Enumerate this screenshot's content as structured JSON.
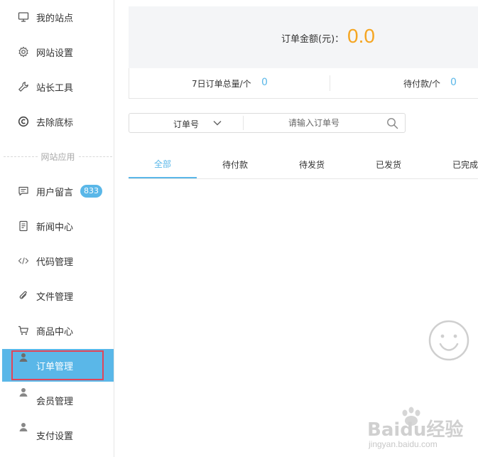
{
  "sidebar": {
    "items": [
      {
        "label": "我的站点",
        "icon": "monitor-icon"
      },
      {
        "label": "网站设置",
        "icon": "gear-icon"
      },
      {
        "label": "站长工具",
        "icon": "wrench-icon"
      },
      {
        "label": "去除底标",
        "icon": "copyright-icon"
      },
      {
        "label": "用户留言",
        "icon": "message-icon",
        "badge": "833"
      },
      {
        "label": "新闻中心",
        "icon": "document-icon"
      },
      {
        "label": "代码管理",
        "icon": "code-icon"
      },
      {
        "label": "文件管理",
        "icon": "paperclip-icon"
      },
      {
        "label": "商品中心",
        "icon": "cart-icon"
      },
      {
        "label": "订单管理",
        "icon": "user-icon",
        "active": true
      },
      {
        "label": "会员管理",
        "icon": "user-icon"
      },
      {
        "label": "支付设置",
        "icon": "user-icon"
      }
    ],
    "section_label": "网站应用"
  },
  "summary": {
    "caption": "订单金额(元)：",
    "amount": "0.0"
  },
  "stats": {
    "weekly_total_label": "7日订单总量/个",
    "weekly_total_value": "0",
    "pending_payment_label": "待付款/个",
    "pending_payment_value": "0"
  },
  "search": {
    "type_label": "订单号",
    "placeholder": "请输入订单号"
  },
  "tabs": [
    {
      "label": "全部",
      "active": true
    },
    {
      "label": "待付款"
    },
    {
      "label": "待发货"
    },
    {
      "label": "已发货"
    },
    {
      "label": "已完成"
    }
  ],
  "watermark": {
    "brand": "Baidu经验",
    "url": "jingyan.baidu.com"
  },
  "colors": {
    "accent": "#5ab7e8",
    "amount": "#f5a623",
    "highlight": "#e0455a"
  }
}
